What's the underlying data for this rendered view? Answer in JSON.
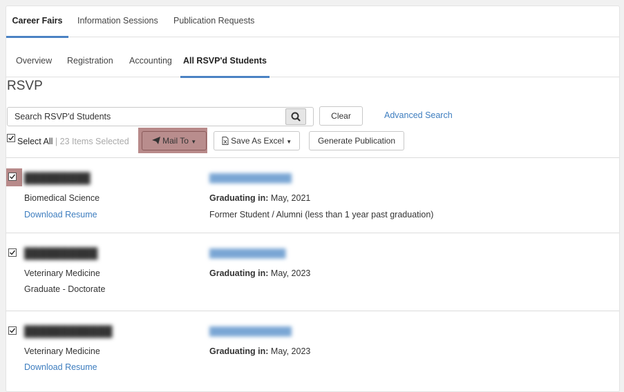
{
  "tabs_top": [
    {
      "label": "Career Fairs",
      "active": true
    },
    {
      "label": "Information Sessions",
      "active": false
    },
    {
      "label": "Publication Requests",
      "active": false
    }
  ],
  "tabs_sub": [
    {
      "label": "Overview",
      "active": false
    },
    {
      "label": "Registration",
      "active": false
    },
    {
      "label": "Accounting",
      "active": false
    },
    {
      "label": "All RSVP'd Students",
      "active": true
    }
  ],
  "page_title": "RSVP",
  "search": {
    "placeholder": "Search RSVP'd Students",
    "value": "",
    "icon": "search-icon"
  },
  "toolbar": {
    "clear_label": "Clear",
    "advanced_search_label": "Advanced Search",
    "select_all_label": "Select All",
    "items_selected": "| 23 Items Selected",
    "mail_to_label": "Mail To",
    "save_excel_label": "Save As Excel",
    "generate_publication_label": "Generate Publication"
  },
  "students": [
    {
      "checked": true,
      "highlighted": true,
      "major": "Biomedical Science",
      "graduating_label": "Graduating in:",
      "graduating_value": "May, 2021",
      "extra_left": "Download Resume",
      "extra_left_is_link": true,
      "extra_right": "Former Student / Alumni (less than 1 year past graduation)"
    },
    {
      "checked": true,
      "highlighted": false,
      "major": "Veterinary Medicine",
      "graduating_label": "Graduating in:",
      "graduating_value": "May, 2023",
      "extra_left": "Graduate - Doctorate",
      "extra_left_is_link": false,
      "extra_right": ""
    },
    {
      "checked": true,
      "highlighted": false,
      "major": "Veterinary Medicine",
      "graduating_label": "Graduating in:",
      "graduating_value": "May, 2023",
      "extra_left": "Download Resume",
      "extra_left_is_link": true,
      "extra_right": ""
    }
  ],
  "colors": {
    "accent": "#4a82c3",
    "link": "#3d7dbf",
    "highlight": "#b98d8d"
  }
}
